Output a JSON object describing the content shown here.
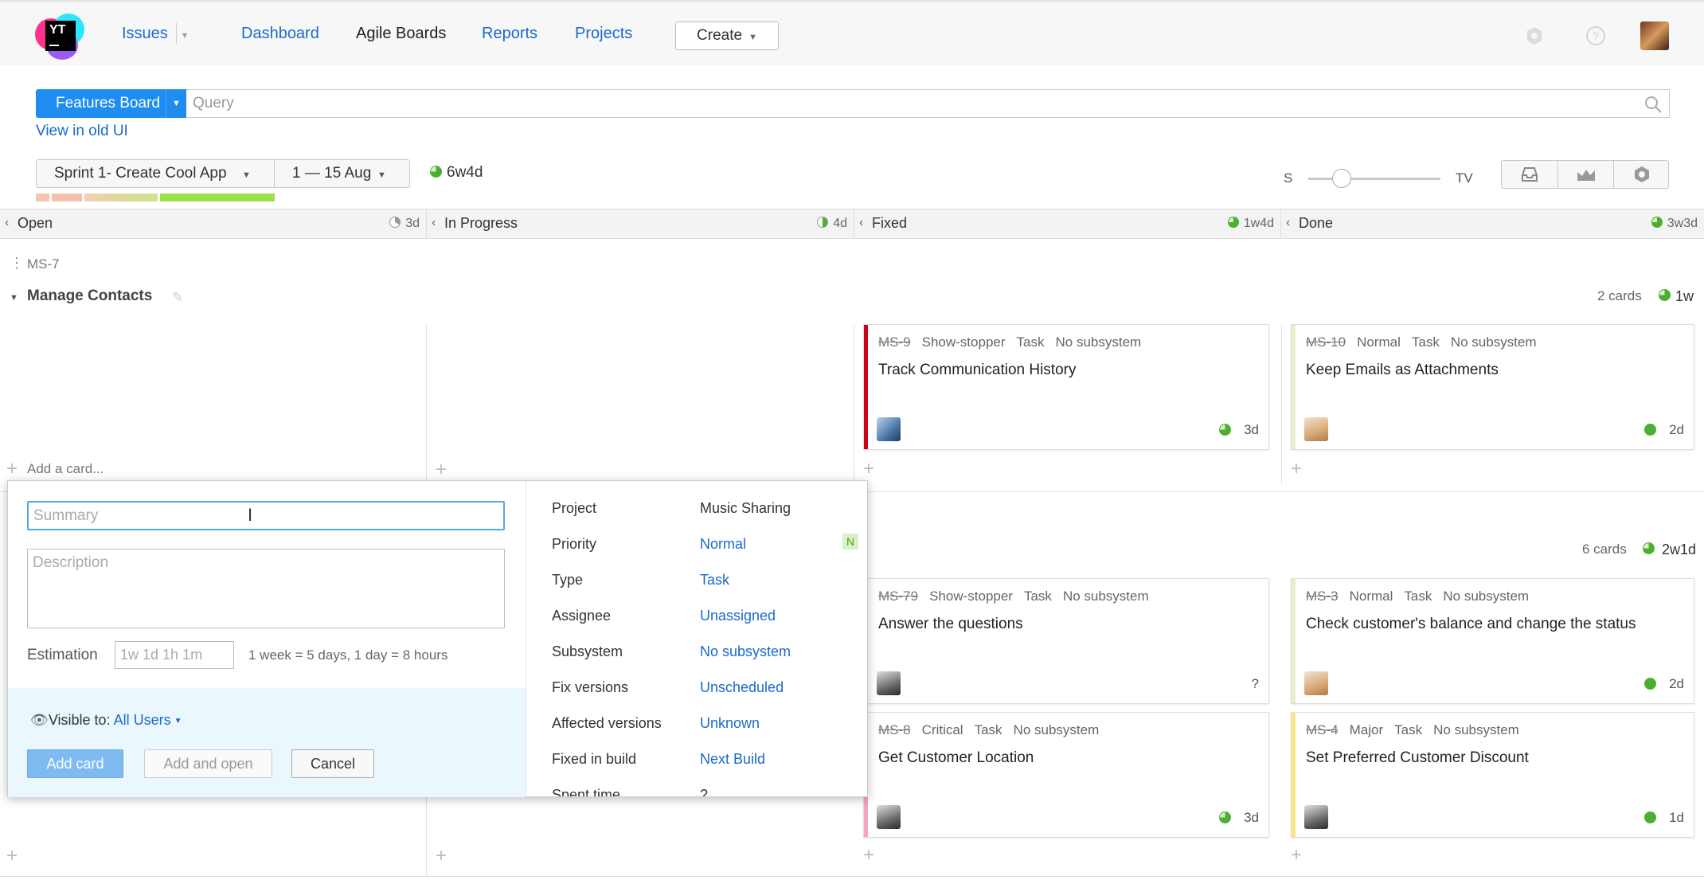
{
  "header": {
    "nav": {
      "issues": "Issues",
      "dashboard": "Dashboard",
      "agile_boards": "Agile Boards",
      "reports": "Reports",
      "projects": "Projects"
    },
    "create_label": "Create"
  },
  "toolbar": {
    "board_name": "Features Board",
    "query_placeholder": "Query",
    "old_ui_link": "View in old UI",
    "sprint": "Sprint 1- Create Cool App",
    "dates": "1 — 15 Aug",
    "sprint_estimate": "6w4d",
    "size_min": "S",
    "size_max": "TV"
  },
  "columns": [
    {
      "name": "Open",
      "estimate": "3d"
    },
    {
      "name": "In Progress",
      "estimate": "4d"
    },
    {
      "name": "Fixed",
      "estimate": "1w4d"
    },
    {
      "name": "Done",
      "estimate": "3w3d"
    }
  ],
  "swimlanes": [
    {
      "id": "MS-7",
      "title": "Manage Contacts",
      "count": "2 cards",
      "estimate": "1w"
    },
    {
      "count": "6 cards",
      "estimate": "2w1d"
    }
  ],
  "add_card_label": "Add a card...",
  "cards": [
    {
      "id": "MS-9",
      "priority": "Show-stopper",
      "type": "Task",
      "subsystem": "No subsystem",
      "title": "Track Communication History",
      "estimate": "3d",
      "priority_color": "#d0021b"
    },
    {
      "id": "MS-10",
      "priority": "Normal",
      "type": "Task",
      "subsystem": "No subsystem",
      "title": "Keep Emails as Attachments",
      "estimate": "2d",
      "priority_color": "#e3f0c8"
    },
    {
      "id": "MS-79",
      "priority": "Show-stopper",
      "type": "Task",
      "subsystem": "No subsystem",
      "title": "Answer the questions",
      "estimate": "?",
      "priority_color": "#d0021b"
    },
    {
      "id": "MS-3",
      "priority": "Normal",
      "type": "Task",
      "subsystem": "No subsystem",
      "title": "Check customer's balance and change the status",
      "estimate": "2d",
      "priority_color": "#e3f0c8"
    },
    {
      "id": "MS-8",
      "priority": "Critical",
      "type": "Task",
      "subsystem": "No subsystem",
      "title": "Get Customer Location",
      "estimate": "3d",
      "priority_color": "#f7a3c6"
    },
    {
      "id": "MS-4",
      "priority": "Major",
      "type": "Task",
      "subsystem": "No subsystem",
      "title": "Set Preferred Customer Discount",
      "estimate": "1d",
      "priority_color": "#f5e783"
    }
  ],
  "new_card_form": {
    "summary_placeholder": "Summary",
    "description_placeholder": "Description",
    "estimation_label": "Estimation",
    "estimation_placeholder": "1w 1d 1h 1m",
    "estimation_hint": "1 week = 5 days, 1 day = 8 hours",
    "visible_to_label": "Visible to:",
    "visible_to_value": "All Users",
    "add_card": "Add card",
    "add_and_open": "Add and open",
    "cancel": "Cancel",
    "priority_badge": "N",
    "fields": [
      {
        "key": "Project",
        "value": "Music Sharing"
      },
      {
        "key": "Priority",
        "value": "Normal"
      },
      {
        "key": "Type",
        "value": "Task"
      },
      {
        "key": "Assignee",
        "value": "Unassigned"
      },
      {
        "key": "Subsystem",
        "value": "No subsystem"
      },
      {
        "key": "Fix versions",
        "value": "Unscheduled"
      },
      {
        "key": "Affected versions",
        "value": "Unknown"
      },
      {
        "key": "Fixed in build",
        "value": "Next Build"
      },
      {
        "key": "Spent time",
        "value": "?"
      }
    ]
  }
}
